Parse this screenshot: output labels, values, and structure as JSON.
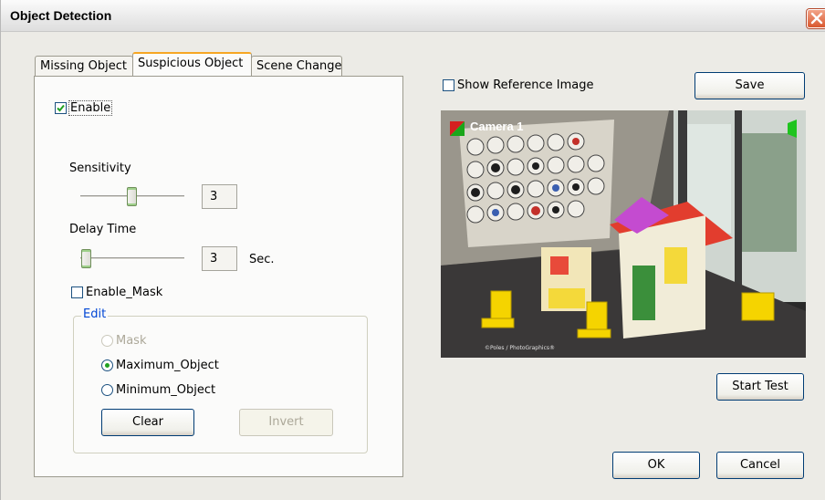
{
  "window": {
    "title": "Object Detection"
  },
  "tabs": [
    {
      "label": "Missing Object"
    },
    {
      "label": "Suspicious Object"
    },
    {
      "label": "Scene Change"
    }
  ],
  "settings": {
    "enable_label": "Enable",
    "enable_checked": true,
    "sensitivity_label": "Sensitivity",
    "sensitivity_value": "3",
    "delay_label": "Delay Time",
    "delay_value": "3",
    "delay_unit": "Sec.",
    "enable_mask_label": "Enable_Mask",
    "enable_mask_checked": false,
    "edit_group_title": "Edit",
    "radio_mask_label": "Mask",
    "radio_max_label": "Maximum_Object",
    "radio_min_label": "Minimum_Object",
    "selected_radio": "Maximum_Object",
    "clear_label": "Clear",
    "invert_label": "Invert"
  },
  "preview": {
    "show_reference_label": "Show Reference Image",
    "show_reference_checked": false,
    "save_label": "Save",
    "camera_label": "Camera 1",
    "watermark": "©Poles / PhotoGraphics®",
    "start_test_label": "Start Test"
  },
  "footer": {
    "ok_label": "OK",
    "cancel_label": "Cancel"
  },
  "colors": {
    "accent_tab": "#f6a623",
    "checkmark": "#21a121",
    "group_title": "#0046d5",
    "close_button": "#d9582f"
  }
}
